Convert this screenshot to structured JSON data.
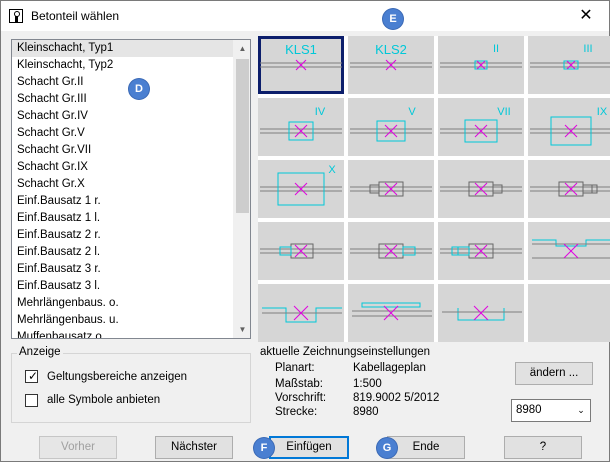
{
  "window": {
    "title": "Betonteil wählen",
    "close_glyph": "✕"
  },
  "markers": {
    "d": "D",
    "e": "E",
    "f": "F",
    "g": "G"
  },
  "part_list": {
    "items": [
      "Kleinschacht, Typ1",
      "Kleinschacht, Typ2",
      "Schacht Gr.II",
      "Schacht Gr.III",
      "Schacht Gr.IV",
      "Schacht Gr.V",
      "Schacht Gr.VII",
      "Schacht Gr.IX",
      "Schacht Gr.X",
      "Einf.Bausatz 1  r.",
      "Einf.Bausatz 1  l.",
      "Einf.Bausatz 2  r.",
      "Einf.Bausatz 2  l.",
      "Einf.Bausatz 3  r.",
      "Einf.Bausatz 3  l.",
      "Mehrlängenbaus. o.",
      "Mehrlängenbaus. u.",
      "Muffenbausatz  o."
    ],
    "selected_index": 0,
    "scroll_up_glyph": "▲",
    "scroll_down_glyph": "▼"
  },
  "symbols": {
    "labels": [
      "KLS1",
      "KLS2",
      "II",
      "III",
      "IV",
      "V",
      "VII",
      "IX",
      "X"
    ],
    "line_color": "#7f7f7f",
    "box_color": "#00c8d8",
    "cross_color": "#e000e0",
    "selected_index": 0
  },
  "display_group": {
    "title": "Anzeige",
    "checkbox_scope": {
      "label": "Geltungsbereiche anzeigen",
      "checked": true
    },
    "checkbox_all": {
      "label": "alle Symbole anbieten",
      "checked": false
    },
    "check_glyph": "✓"
  },
  "settings_group": {
    "title": "aktuelle Zeichnungseinstellungen",
    "rows": [
      {
        "key": "Planart:",
        "value": "Kabellageplan"
      },
      {
        "key": "Maßstab:",
        "value": "1:500"
      },
      {
        "key": "Vorschrift:",
        "value": "819.9002 5/2012"
      },
      {
        "key": "Strecke:",
        "value": "8980"
      }
    ],
    "change_button": "ändern ...",
    "route_select_value": "8980",
    "dropdown_glyph": "⌄"
  },
  "buttons": {
    "previous": "Vorher",
    "next": "Nächster",
    "insert": "Einfügen",
    "finish": "Ende",
    "help": "?"
  }
}
